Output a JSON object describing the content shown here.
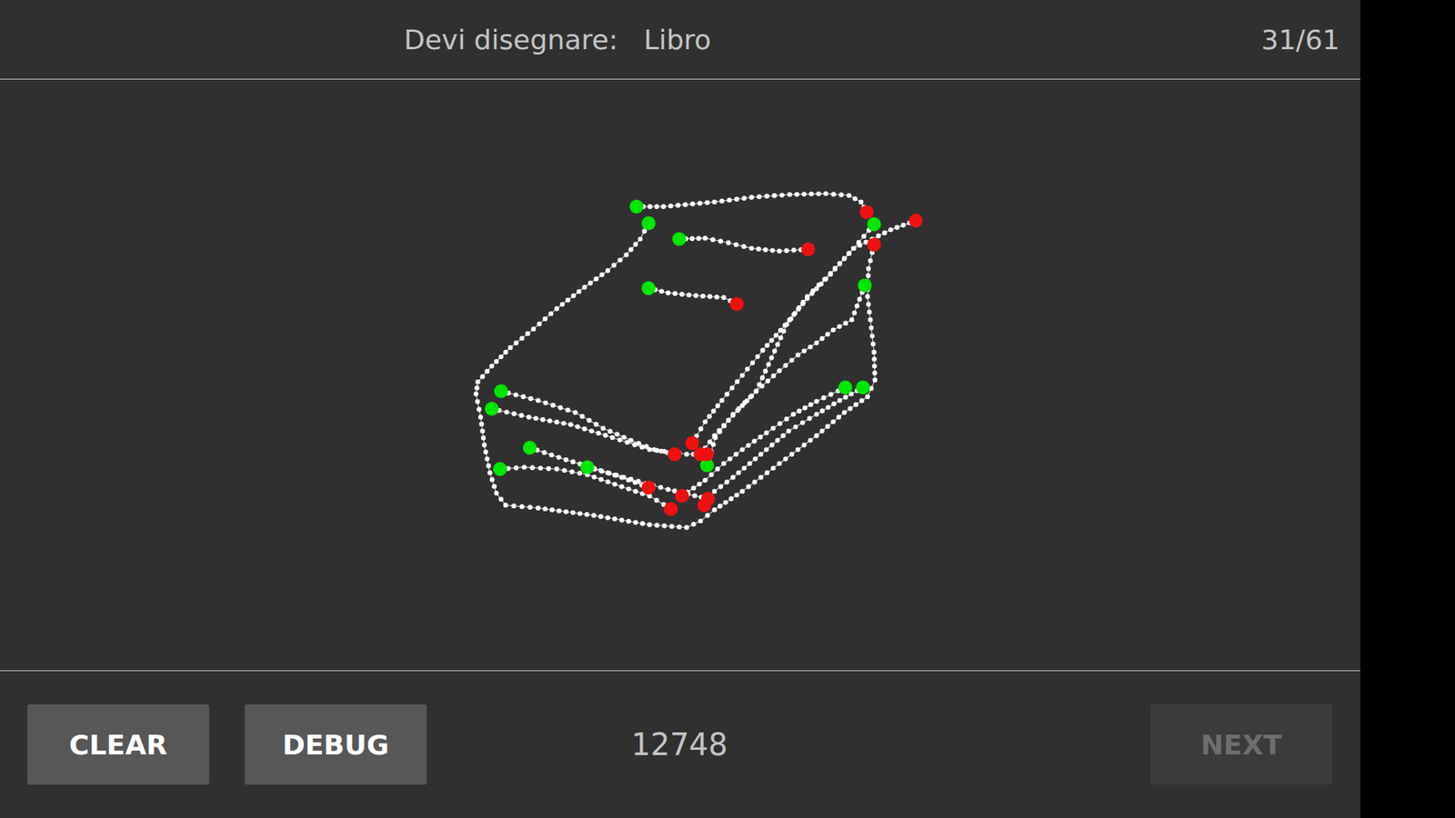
{
  "header": {
    "prompt": "Devi disegnare:",
    "word": "Libro",
    "counter": "31/61"
  },
  "footer": {
    "buttons_left": [
      {
        "label": "CLEAR",
        "disabled": false
      },
      {
        "label": "DEBUG",
        "disabled": false
      }
    ],
    "score": "12748",
    "buttons_right": [
      {
        "label": "NEXT",
        "disabled": true
      }
    ]
  }
}
